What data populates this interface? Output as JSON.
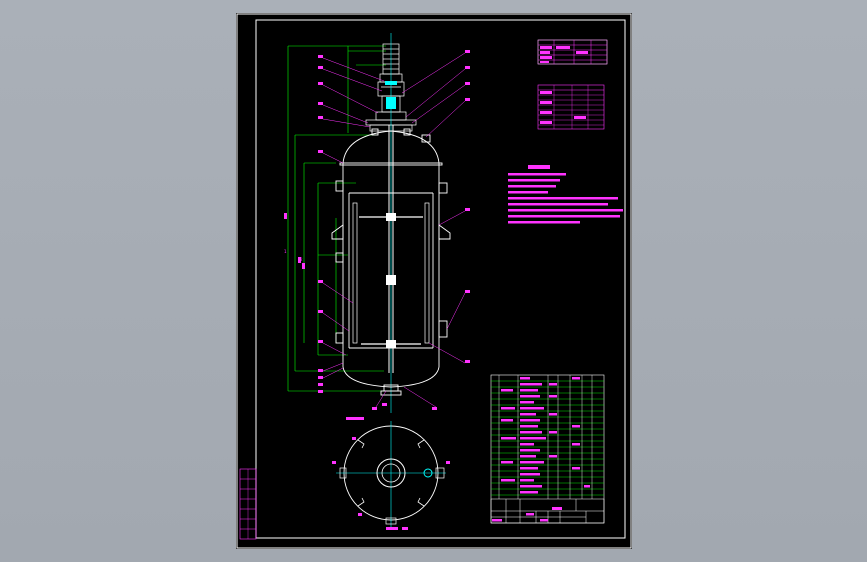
{
  "drawing": {
    "bg_color": "#000000",
    "viewport_color": "#a6acb4",
    "accent_magenta": "#ff33ff",
    "accent_white": "#ffffff",
    "accent_green": "#00ff00",
    "accent_yellow": "#ffff00",
    "accent_cyan": "#00ffff"
  },
  "text": {
    "dim_a": "1",
    "dim_b": "2",
    "note_small": "1"
  }
}
